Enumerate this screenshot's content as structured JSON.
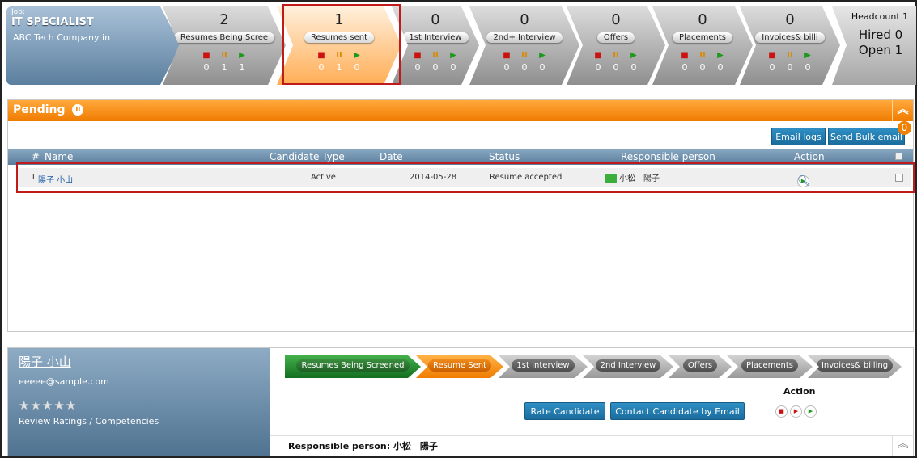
{
  "job": {
    "label": "Job:",
    "title": "IT SPECIALIST",
    "company": "ABC Tech Company in"
  },
  "stages": [
    {
      "count": "2",
      "name": "Resumes Being Scree",
      "stopped": "0",
      "paused": "1",
      "active": "1"
    },
    {
      "count": "1",
      "name": "Resumes sent",
      "stopped": "0",
      "paused": "1",
      "active": "0"
    },
    {
      "count": "0",
      "name": "1st Interview",
      "stopped": "0",
      "paused": "0",
      "active": "0"
    },
    {
      "count": "0",
      "name": "2nd+ Interview",
      "stopped": "0",
      "paused": "0",
      "active": "0"
    },
    {
      "count": "0",
      "name": "Offers",
      "stopped": "0",
      "paused": "0",
      "active": "0"
    },
    {
      "count": "0",
      "name": "Placements",
      "stopped": "0",
      "paused": "0",
      "active": "0"
    },
    {
      "count": "0",
      "name": "Invoices& billi",
      "stopped": "0",
      "paused": "0",
      "active": "0"
    }
  ],
  "headcount": {
    "label": "Headcount 1",
    "hired": "Hired 0",
    "open": "Open 1"
  },
  "pending": {
    "title": "Pending",
    "email_logs": "Email logs",
    "send_bulk": "Send Bulk email",
    "bulk_badge": "0",
    "columns": {
      "num": "#",
      "name": "Name",
      "type": "Candidate Type",
      "date": "Date",
      "status": "Status",
      "responsible": "Responsible person",
      "action": "Action"
    },
    "rows": [
      {
        "num": "1",
        "name": "陽子 小山",
        "type": "Active",
        "date": "2014-05-28",
        "status": "Resume accepted",
        "responsible": "小松　陽子"
      }
    ]
  },
  "candidate": {
    "name": "陽子 小山",
    "email": "eeeee@sample.com",
    "stars": "★★★★★",
    "review": "Review Ratings / Competencies",
    "steps": [
      "Resumes Being Screened",
      "Resume Sent",
      "1st Interview",
      "2nd Interview",
      "Offers",
      "Placements",
      "Invoices& billing"
    ],
    "rate_button": "Rate Candidate",
    "contact_button": "Contact Candidate by Email",
    "action_label": "Action",
    "responsible_label": "Responsible person:",
    "responsible_value": "小松　陽子"
  },
  "icons": {
    "stop": "stop-icon",
    "pause": "pause-icon",
    "play": "play-icon",
    "search": "magnifier-icon",
    "collapse": "chevron-up-icon"
  },
  "colors": {
    "accent_orange": "#f08000",
    "button_blue": "#1f7bb0",
    "stage_gray": "#9a9a9a",
    "job_blue": "#5b7f9e",
    "highlight_red": "#c01a1a",
    "step_green": "#2a8f34"
  }
}
